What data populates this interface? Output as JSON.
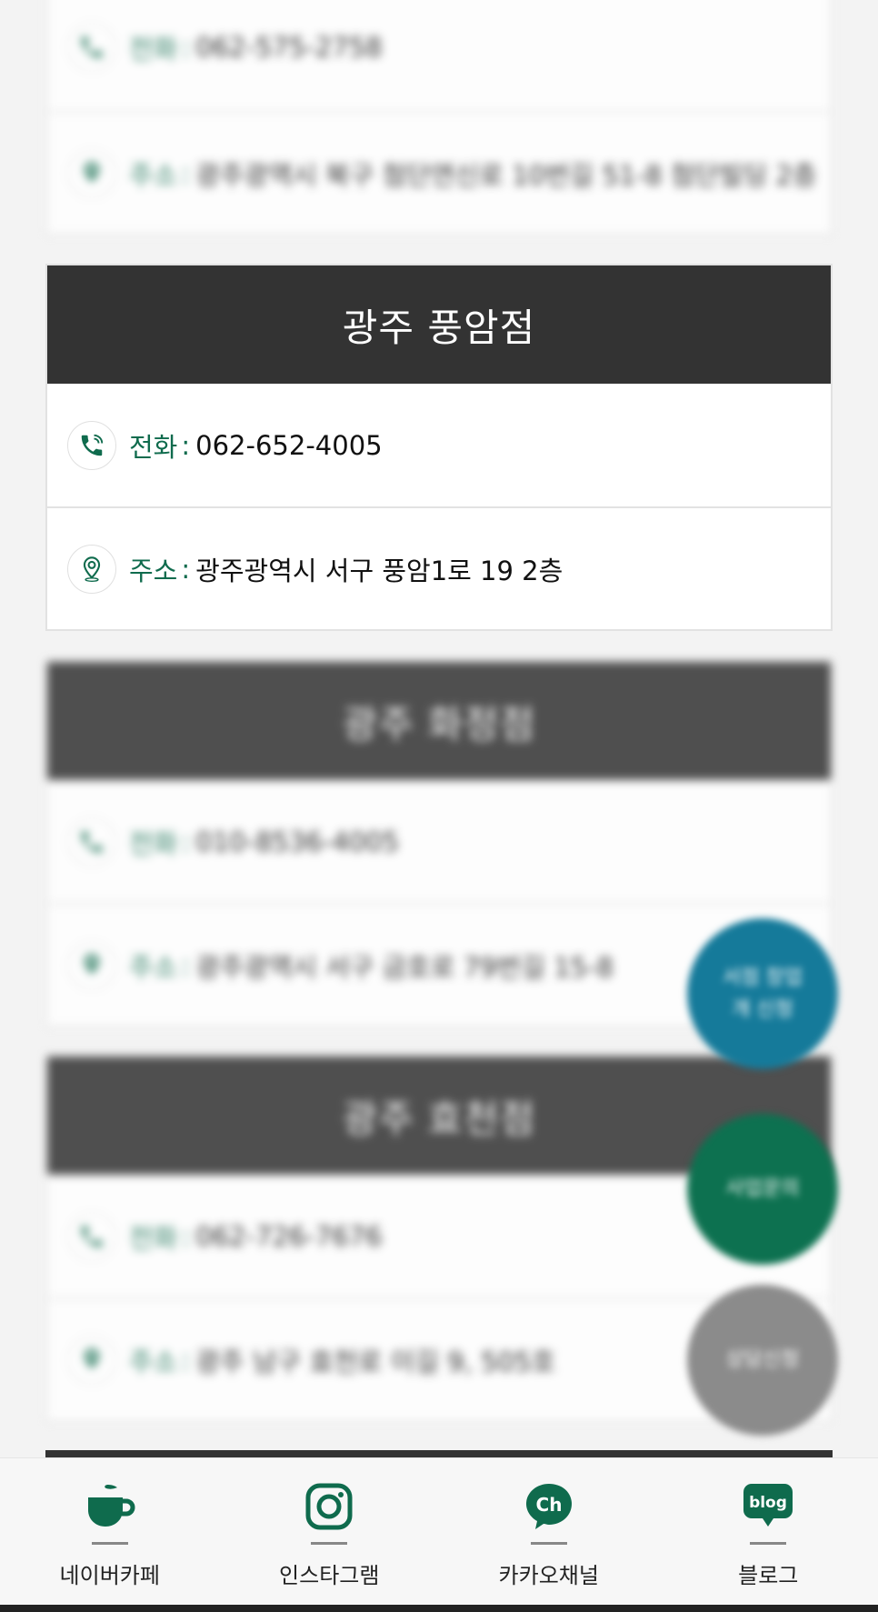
{
  "stores": [
    {
      "name": "",
      "phone_label": "전화",
      "phone": "062-575-2758",
      "address_label": "주소",
      "address": "광주광역시 북구 첨단연신로 10번길 51-8 첨단빌딩 2층"
    },
    {
      "name": "광주 풍암점",
      "phone_label": "전화",
      "phone": "062-652-4005",
      "address_label": "주소",
      "address": "광주광역시 서구 풍암1로 19 2층"
    },
    {
      "name": "광주 화정점",
      "phone_label": "전화",
      "phone": "010-8536-4005",
      "address_label": "주소",
      "address": "광주광역시 서구 금호로 79번길 15-8"
    },
    {
      "name": "광주 효천점",
      "phone_label": "전화",
      "phone": "062-726-7676",
      "address_label": "주소",
      "address": "광주 남구 효천로 이길 9, 505호"
    }
  ],
  "separator": ":",
  "fabs": {
    "blue_label": "서점 창업개 신청",
    "green_label": "사업문의",
    "gray_label": "상담신청"
  },
  "bottom_nav": [
    {
      "label": "네이버카페",
      "icon": "coffee-cup-icon"
    },
    {
      "label": "인스타그램",
      "icon": "instagram-icon"
    },
    {
      "label": "카카오채널",
      "icon": "kakao-channel-icon"
    },
    {
      "label": "블로그",
      "icon": "blog-icon"
    }
  ],
  "colors": {
    "header": "#333333",
    "accent_green": "#0f6b4d",
    "fab_blue": "#157a9a",
    "fab_green": "#0d7150",
    "fab_gray": "#8b8b8b"
  }
}
